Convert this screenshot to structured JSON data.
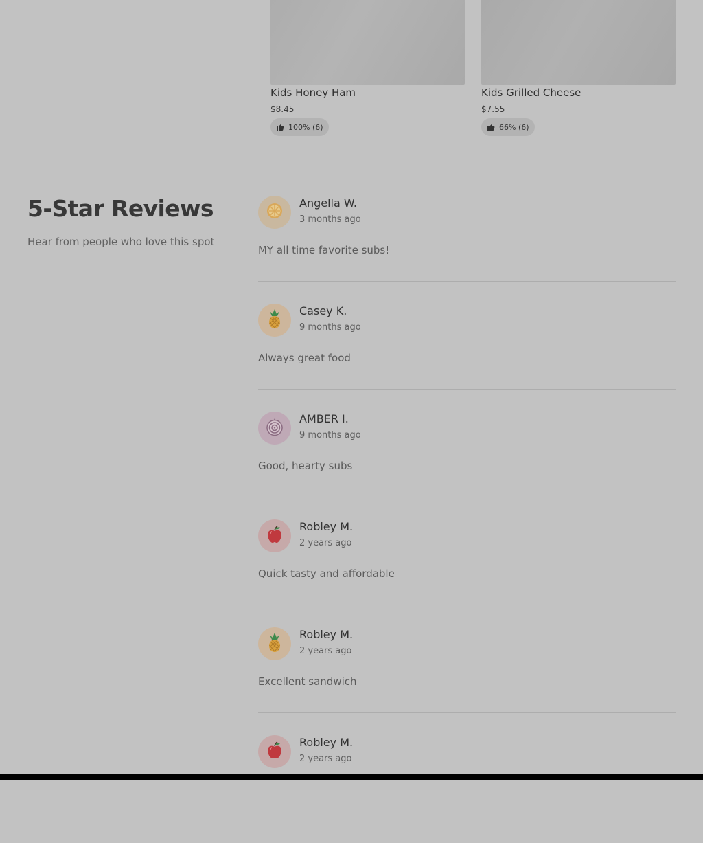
{
  "products": [
    {
      "name": "Kids Honey Ham",
      "price": "$8.45",
      "rating": "100% (6)"
    },
    {
      "name": "Kids Grilled Cheese",
      "price": "$7.55",
      "rating": "66% (6)"
    }
  ],
  "reviews_section": {
    "title": "5-Star Reviews",
    "subtitle": "Hear from people who love this spot"
  },
  "reviews": [
    {
      "author": "Angella W.",
      "time": "3 months ago",
      "text": "MY all time favorite subs!",
      "avatar_icon": "lemon-icon"
    },
    {
      "author": "Casey K.",
      "time": "9 months ago",
      "text": "Always great food",
      "avatar_icon": "pineapple-icon"
    },
    {
      "author": "AMBER I.",
      "time": "9 months ago",
      "text": "Good, hearty subs",
      "avatar_icon": "onion-icon"
    },
    {
      "author": "Robley M.",
      "time": "2 years ago",
      "text": "Quick tasty and affordable",
      "avatar_icon": "apple-icon"
    },
    {
      "author": "Robley M.",
      "time": "2 years ago",
      "text": "Excellent sandwich",
      "avatar_icon": "pineapple-icon"
    },
    {
      "author": "Robley M.",
      "time": "2 years ago",
      "text": "",
      "avatar_icon": "apple-icon"
    }
  ],
  "colors": {
    "overlay_background": "#c2c2c2",
    "heading": "#383838",
    "body_text": "#5a5a5a"
  }
}
